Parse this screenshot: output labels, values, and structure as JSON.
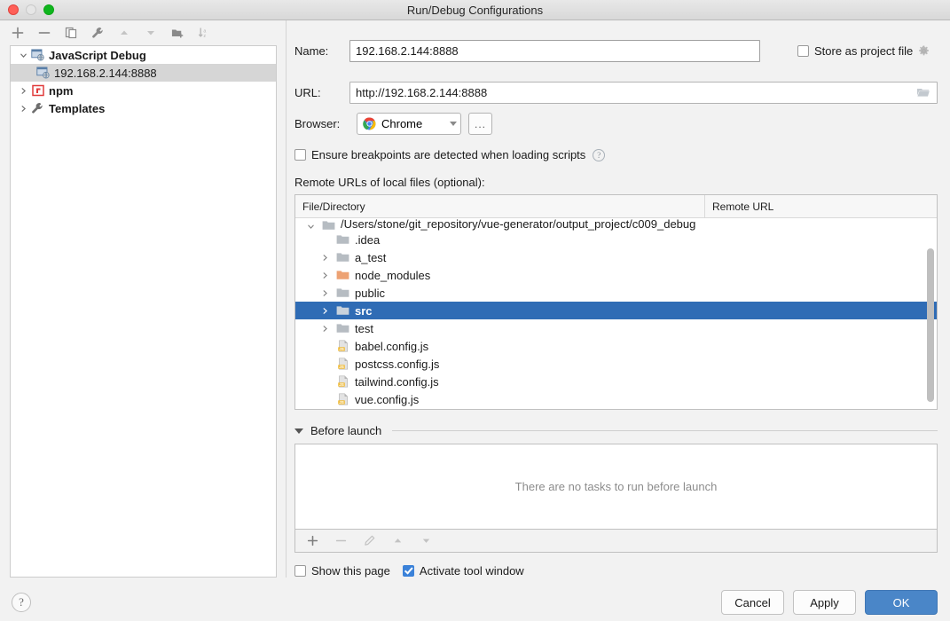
{
  "window": {
    "title": "Run/Debug Configurations",
    "traffic_lights": [
      "close-button",
      "minimize-button",
      "zoom-button"
    ]
  },
  "left_panel": {
    "toolbar": [
      {
        "name": "add-configuration-button",
        "icon": "plus-icon"
      },
      {
        "name": "remove-configuration-button",
        "icon": "minus-icon"
      },
      {
        "name": "copy-configuration-button",
        "icon": "copy-icon"
      },
      {
        "name": "edit-templates-button",
        "icon": "wrench-icon"
      },
      {
        "name": "move-up-button",
        "icon": "arrow-up-icon"
      },
      {
        "name": "move-down-button",
        "icon": "arrow-down-icon"
      },
      {
        "name": "new-folder-button",
        "icon": "folder-add-icon"
      },
      {
        "name": "sort-configurations-button",
        "icon": "sort-az-icon"
      }
    ],
    "tree": [
      {
        "label": "JavaScript Debug",
        "icon": "javascript-debug-icon",
        "expanded": true,
        "bold": true,
        "level": 0,
        "selected": false,
        "twisty": "chevron-down"
      },
      {
        "label": "192.168.2.144:8888",
        "icon": "javascript-debug-icon",
        "expanded": false,
        "bold": false,
        "level": 1,
        "selected": true,
        "twisty": ""
      },
      {
        "label": "npm",
        "icon": "npm-icon",
        "expanded": false,
        "bold": true,
        "level": 0,
        "selected": false,
        "twisty": "chevron-right"
      },
      {
        "label": "Templates",
        "icon": "wrench-icon",
        "expanded": false,
        "bold": true,
        "level": 0,
        "selected": false,
        "twisty": "chevron-right"
      }
    ]
  },
  "form": {
    "name_label": "Name:",
    "name_value": "192.168.2.144:8888",
    "store_as_project_file_label": "Store as project file",
    "store_as_project_file_checked": false,
    "store_gear_icon": "gear-icon",
    "url_label": "URL:",
    "url_value": "http://192.168.2.144:8888",
    "url_browse_icon": "folder-open-icon",
    "browser_label": "Browser:",
    "browser_value": "Chrome",
    "browser_icon": "chrome-icon",
    "browser_more_label": "...",
    "ensure_breakpoints_label": "Ensure breakpoints are detected when loading scripts",
    "ensure_breakpoints_checked": false,
    "ensure_breakpoints_help_icon": "help-icon",
    "remote_urls_label": "Remote URLs of local files (optional):"
  },
  "file_table": {
    "columns": [
      "File/Directory",
      "Remote URL"
    ],
    "rows": [
      {
        "label": "/Users/stone/git_repository/vue-generator/output_project/c009_debug",
        "icon": "folder-icon",
        "twisty": "chevron-down",
        "level": 0,
        "selected": false,
        "remote_url": "",
        "clipped": true
      },
      {
        "label": ".idea",
        "icon": "folder-icon",
        "twisty": "",
        "level": 1,
        "selected": false,
        "remote_url": ""
      },
      {
        "label": "a_test",
        "icon": "folder-icon",
        "twisty": "chevron-right",
        "level": 1,
        "selected": false,
        "remote_url": ""
      },
      {
        "label": "node_modules",
        "icon": "folder-orange-icon",
        "twisty": "chevron-right",
        "level": 1,
        "selected": false,
        "remote_url": ""
      },
      {
        "label": "public",
        "icon": "folder-icon",
        "twisty": "chevron-right",
        "level": 1,
        "selected": false,
        "remote_url": ""
      },
      {
        "label": "src",
        "icon": "folder-icon",
        "twisty": "chevron-right",
        "level": 1,
        "selected": true,
        "remote_url": ""
      },
      {
        "label": "test",
        "icon": "folder-icon",
        "twisty": "chevron-right",
        "level": 1,
        "selected": false,
        "remote_url": ""
      },
      {
        "label": "babel.config.js",
        "icon": "js-file-icon",
        "twisty": "",
        "level": 1,
        "selected": false,
        "remote_url": ""
      },
      {
        "label": "postcss.config.js",
        "icon": "js-file-icon",
        "twisty": "",
        "level": 1,
        "selected": false,
        "remote_url": ""
      },
      {
        "label": "tailwind.config.js",
        "icon": "js-file-icon",
        "twisty": "",
        "level": 1,
        "selected": false,
        "remote_url": ""
      },
      {
        "label": "vue.config.js",
        "icon": "js-file-icon",
        "twisty": "",
        "level": 1,
        "selected": false,
        "remote_url": ""
      }
    ]
  },
  "before_launch": {
    "title": "Before launch",
    "expanded": true,
    "empty_message": "There are no tasks to run before launch",
    "toolbar": [
      {
        "name": "add-task-button",
        "icon": "plus-icon"
      },
      {
        "name": "remove-task-button",
        "icon": "minus-icon"
      },
      {
        "name": "edit-task-button",
        "icon": "pencil-icon"
      },
      {
        "name": "move-task-up-button",
        "icon": "arrow-up-icon"
      },
      {
        "name": "move-task-down-button",
        "icon": "arrow-down-icon"
      }
    ],
    "show_this_page_label": "Show this page",
    "show_this_page_checked": false,
    "activate_tool_window_label": "Activate tool window",
    "activate_tool_window_checked": true
  },
  "footer": {
    "help_label": "?",
    "cancel_label": "Cancel",
    "apply_label": "Apply",
    "ok_label": "OK"
  },
  "colors": {
    "selection_blue": "#2f6cb5",
    "primary_button": "#4a86c8",
    "checkbox_checked": "#3b82d9",
    "folder_orange": "#e8a165",
    "window_bg": "#f2f2f2"
  }
}
